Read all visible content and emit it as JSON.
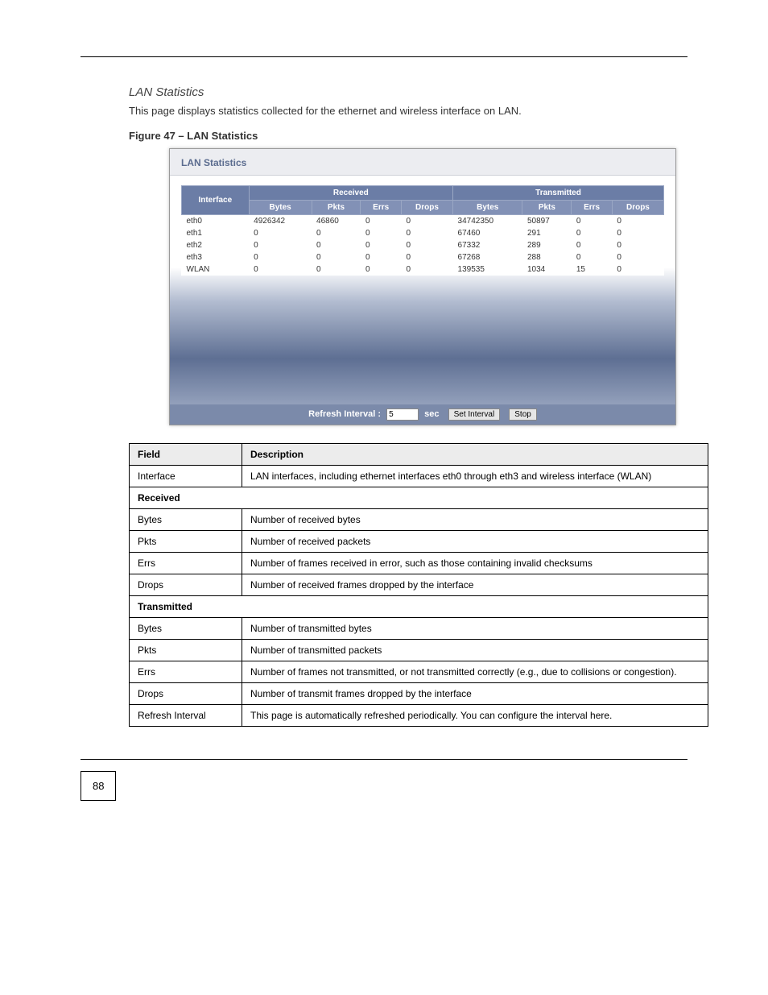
{
  "section_heading": "LAN Statistics",
  "intro_text": "This page displays statistics collected for the ethernet and wireless interface on LAN.",
  "figure_caption": "Figure 47 – LAN Statistics",
  "screenshot": {
    "title": "LAN Statistics",
    "headers": {
      "interface": "Interface",
      "received": "Received",
      "transmitted": "Transmitted",
      "sub": [
        "Bytes",
        "Pkts",
        "Errs",
        "Drops",
        "Bytes",
        "Pkts",
        "Errs",
        "Drops"
      ]
    },
    "rows": [
      {
        "iface": "eth0",
        "r_bytes": "4926342",
        "r_pkts": "46860",
        "r_errs": "0",
        "r_drops": "0",
        "t_bytes": "34742350",
        "t_pkts": "50897",
        "t_errs": "0",
        "t_drops": "0"
      },
      {
        "iface": "eth1",
        "r_bytes": "0",
        "r_pkts": "0",
        "r_errs": "0",
        "r_drops": "0",
        "t_bytes": "67460",
        "t_pkts": "291",
        "t_errs": "0",
        "t_drops": "0"
      },
      {
        "iface": "eth2",
        "r_bytes": "0",
        "r_pkts": "0",
        "r_errs": "0",
        "r_drops": "0",
        "t_bytes": "67332",
        "t_pkts": "289",
        "t_errs": "0",
        "t_drops": "0"
      },
      {
        "iface": "eth3",
        "r_bytes": "0",
        "r_pkts": "0",
        "r_errs": "0",
        "r_drops": "0",
        "t_bytes": "67268",
        "t_pkts": "288",
        "t_errs": "0",
        "t_drops": "0"
      },
      {
        "iface": "WLAN",
        "r_bytes": "0",
        "r_pkts": "0",
        "r_errs": "0",
        "r_drops": "0",
        "t_bytes": "139535",
        "t_pkts": "1034",
        "t_errs": "15",
        "t_drops": "0"
      }
    ],
    "footer": {
      "refresh_label": "Refresh Interval :",
      "refresh_value": "5",
      "sec_label": "sec",
      "set_btn": "Set Interval",
      "stop_btn": "Stop"
    }
  },
  "desc_table": {
    "head_field": "Field",
    "head_desc": "Description",
    "rows": [
      {
        "type": "row",
        "field": "Interface",
        "desc": "LAN interfaces, including ethernet interfaces eth0 through eth3 and wireless interface (WLAN)"
      },
      {
        "type": "section",
        "label": "Received"
      },
      {
        "type": "row",
        "field": "Bytes",
        "desc": "Number of received bytes"
      },
      {
        "type": "row",
        "field": "Pkts",
        "desc": "Number of received packets"
      },
      {
        "type": "row",
        "field": "Errs",
        "desc": "Number of frames received in error, such as those containing invalid checksums"
      },
      {
        "type": "row",
        "field": "Drops",
        "desc": "Number of received frames dropped by the interface"
      },
      {
        "type": "section",
        "label": "Transmitted"
      },
      {
        "type": "row",
        "field": "Bytes",
        "desc": "Number of transmitted bytes"
      },
      {
        "type": "row",
        "field": "Pkts",
        "desc": "Number of transmitted packets"
      },
      {
        "type": "row",
        "field": "Errs",
        "desc": "Number of frames not transmitted, or not transmitted correctly (e.g., due to collisions or congestion)."
      },
      {
        "type": "row",
        "field": "Drops",
        "desc": "Number of transmit frames dropped by the interface"
      },
      {
        "type": "row",
        "field": "Refresh Interval",
        "desc": "This page is automatically refreshed periodically. You can configure the interval here."
      }
    ]
  },
  "page_number": "88"
}
